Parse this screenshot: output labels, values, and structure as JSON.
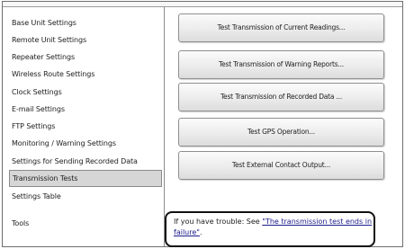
{
  "sidebar": {
    "items": [
      {
        "label": "Base Unit Settings"
      },
      {
        "label": "Remote Unit Settings"
      },
      {
        "label": "Repeater Settings"
      },
      {
        "label": "Wireless Route Settings"
      },
      {
        "label": "Clock Settings"
      },
      {
        "label": "E-mail Settings"
      },
      {
        "label": "FTP Settings"
      },
      {
        "label": "Monitoring / Warning Settings"
      },
      {
        "label": "Settings for Sending Recorded Data"
      },
      {
        "label": "Transmission Tests",
        "selected": true
      },
      {
        "label": "Settings Table"
      },
      {
        "label": "Tools"
      }
    ]
  },
  "buttons": {
    "current": "Test Transmission of Current Readings...",
    "warning": "Test Transmission of Warning Reports...",
    "recorded": "Test Transmission of Recorded Data ...",
    "gps": "Test GPS Operation...",
    "external": "Test External Contact Output..."
  },
  "trouble": {
    "prefix": "If you have trouble: See ",
    "link": "\"The transmission test ends in failure\"",
    "suffix": "."
  },
  "colors": {
    "selected_bg": "#d6d6d6",
    "link": "#1a1a8c",
    "border": "#8c8c8c"
  }
}
